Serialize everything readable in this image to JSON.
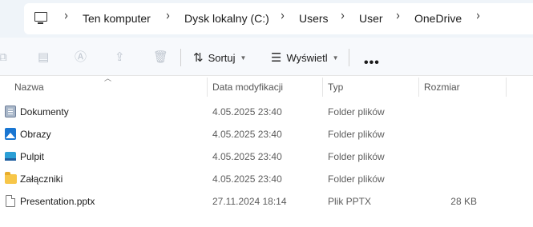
{
  "address": {
    "crumbs": [
      "Ten komputer",
      "Dysk lokalny (C:)",
      "Users",
      "User",
      "OneDrive"
    ],
    "separator": "›",
    "root_icon": "computer-icon"
  },
  "toolbar": {
    "icons": [
      "cut-icon",
      "copy-icon",
      "rename-icon",
      "share-icon",
      "delete-icon"
    ],
    "sort_label": "Sortuj",
    "view_label": "Wyświetl",
    "more_label": "•••"
  },
  "columns": {
    "name": "Nazwa",
    "date": "Data modyfikacji",
    "type": "Typ",
    "size": "Rozmiar"
  },
  "rows": [
    {
      "name": "Dokumenty",
      "date": "4.05.2025 23:40",
      "type": "Folder plików",
      "size": "",
      "icon": "documents-folder-icon"
    },
    {
      "name": "Obrazy",
      "date": "4.05.2025 23:40",
      "type": "Folder plików",
      "size": "",
      "icon": "pictures-folder-icon"
    },
    {
      "name": "Pulpit",
      "date": "4.05.2025 23:40",
      "type": "Folder plików",
      "size": "",
      "icon": "desktop-folder-icon"
    },
    {
      "name": "Załączniki",
      "date": "4.05.2025 23:40",
      "type": "Folder plików",
      "size": "",
      "icon": "folder-icon"
    },
    {
      "name": "Presentation.pptx",
      "date": "27.11.2024 18:14",
      "type": "Plik PPTX",
      "size": "28 KB",
      "icon": "file-icon"
    }
  ]
}
